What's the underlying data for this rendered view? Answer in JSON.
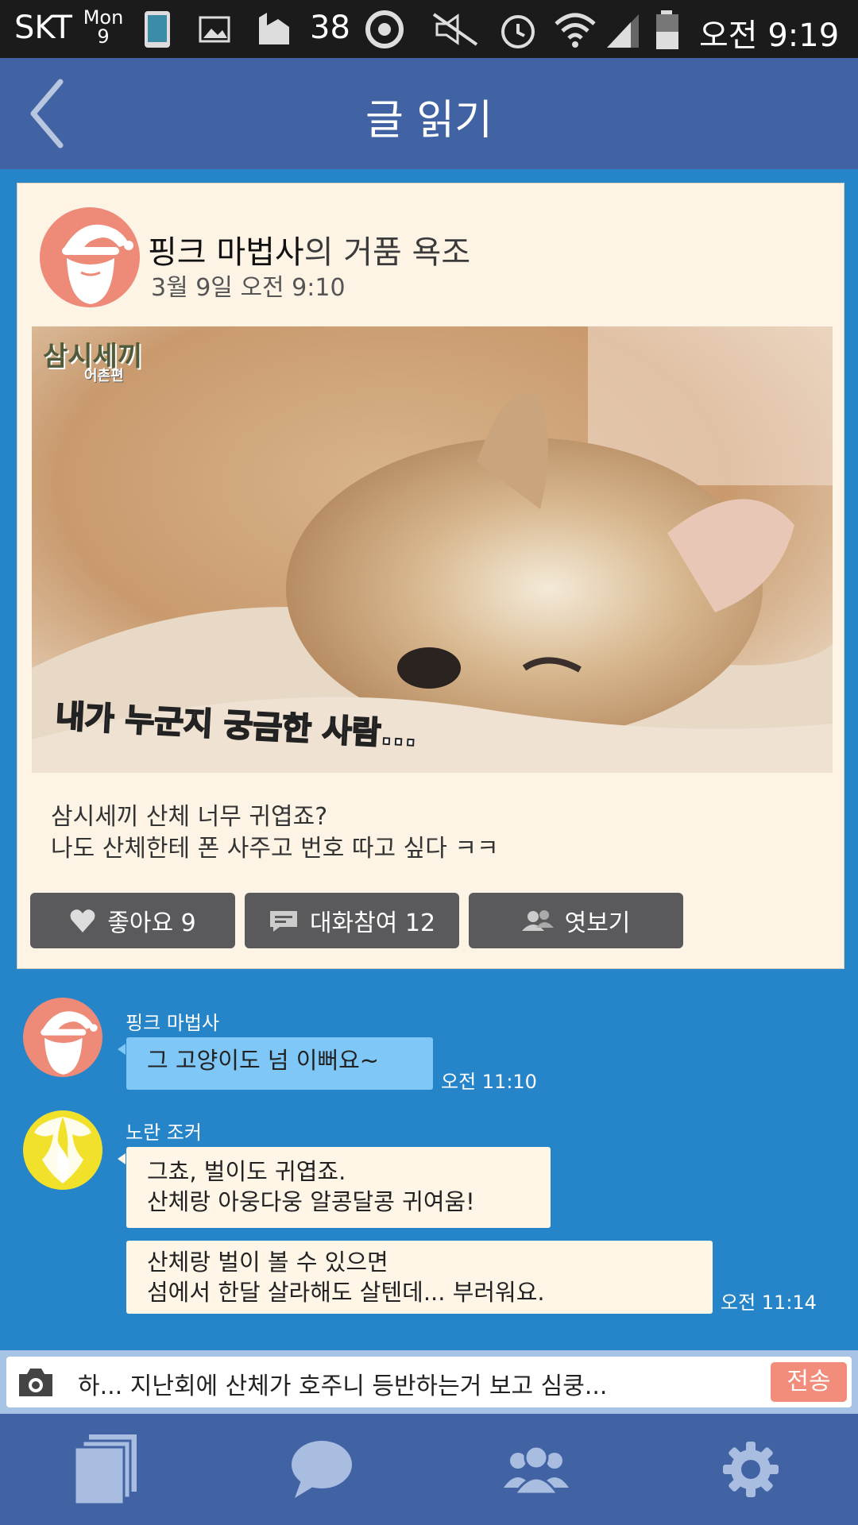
{
  "status_bar": {
    "carrier": "SKT",
    "day": "Mon",
    "date": "9",
    "notification_count": "38",
    "time": "오전 9:19"
  },
  "header": {
    "title": "글 읽기"
  },
  "post": {
    "author": "핑크 마법사",
    "title_suffix": "의 거품 욕조",
    "date": "3월 9일 오전 9:10",
    "image_caption_logo": "삼시세끼",
    "image_caption_sub": "어촌편",
    "image_subtitle": "내가 누군지 궁금한 사람...",
    "text_line1": "삼시세끼 산체 너무 귀엽죠?",
    "text_line2": "나도 산체한테 폰 사주고 번호 따고 싶다 ㅋㅋ",
    "actions": {
      "like_label": "좋아요 9",
      "comment_label": "대화참여 12",
      "peek_label": "엿보기"
    }
  },
  "comments": [
    {
      "author": "핑크 마법사",
      "messages": [
        {
          "lines": [
            "그 고양이도 넘 이뻐요~"
          ],
          "time": "오전 11:10"
        }
      ]
    },
    {
      "author": "노란 조커",
      "messages": [
        {
          "lines": [
            "그쵸, 벌이도 귀엽죠.",
            "산체랑 아웅다웅 알콩달콩 귀여움!"
          ],
          "time": ""
        },
        {
          "lines": [
            "산체랑 벌이 볼 수 있으면",
            "섬에서 한달 살라해도 살텐데... 부러워요."
          ],
          "time": "오전 11:14"
        }
      ]
    }
  ],
  "input": {
    "value": "하... 지난회에 산체가 호주니 등반하는거 보고 심쿵...",
    "send_label": "전송"
  },
  "bottom_nav": {
    "items": [
      "posts-icon",
      "chat-icon",
      "friends-icon",
      "settings-icon"
    ]
  },
  "colors": {
    "header": "#4263a3",
    "background": "#2585c8",
    "card": "#fdf4e6",
    "avatar_pink": "#ee8a78",
    "avatar_yellow": "#f1e12a",
    "bubble_blue": "#7ec7f6",
    "send_button": "#f28c7b"
  }
}
